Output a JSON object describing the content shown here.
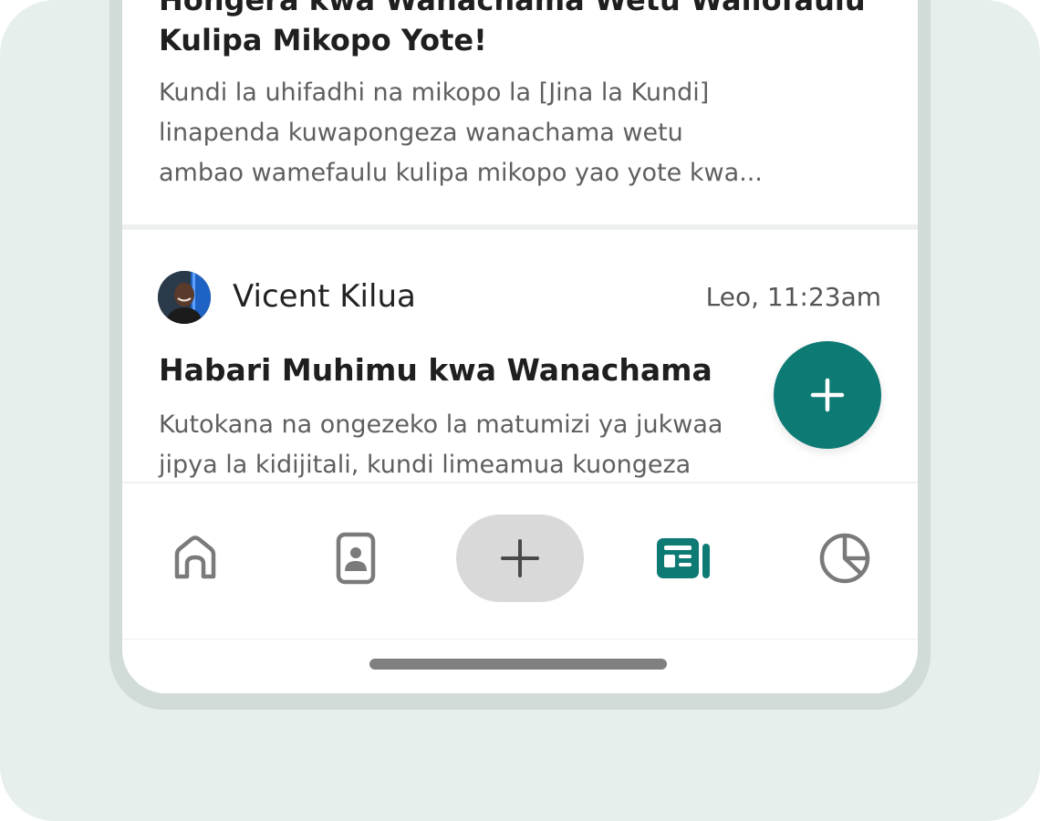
{
  "post_1": {
    "title": "Hongera kwa Wanachama Wetu Waliofaulu Kulipa Mikopo Yote!",
    "body": "Kundi la uhifadhi na mikopo la [Jina la Kundi]\nlinapenda kuwapongeza wanachama wetu\nambao wamefaulu kulipa mikopo yao yote kwa..."
  },
  "post_2": {
    "author": "Vicent Kilua",
    "time": "Leo, 11:23am",
    "title": "Habari Muhimu kwa Wanachama",
    "body": "Kutokana na ongezeko la matumizi ya jukwaa\njipya la kidijitali, kundi limeamua kuongeza"
  },
  "fab": {
    "icon": "plus-icon",
    "color": "#0d7a74"
  },
  "bottom_nav": {
    "items": [
      {
        "icon": "home-icon",
        "active": false
      },
      {
        "icon": "contact-card-icon",
        "active": false
      },
      {
        "icon": "plus-icon",
        "active": false
      },
      {
        "icon": "newspaper-icon",
        "active": true
      },
      {
        "icon": "pie-chart-icon",
        "active": false
      }
    ],
    "active_color": "#0d7a74",
    "inactive_color": "#7a7a7a"
  }
}
